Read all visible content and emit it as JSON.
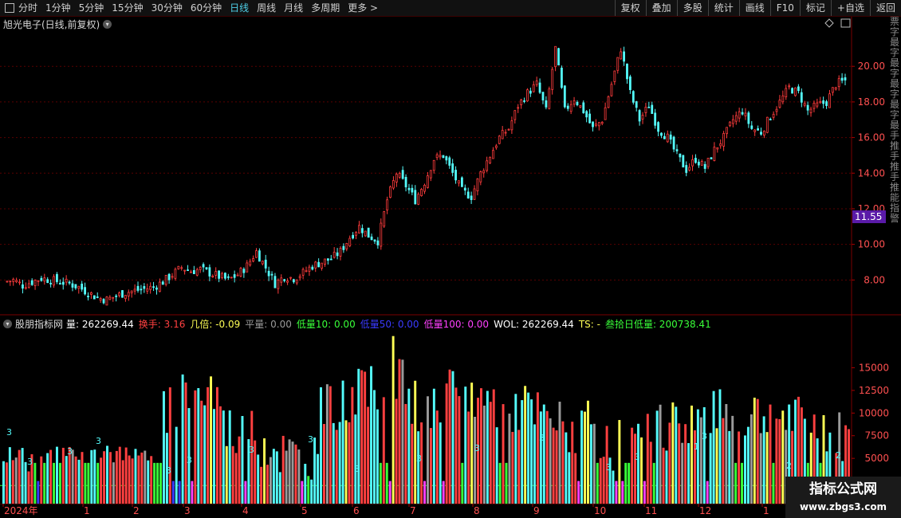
{
  "toolbar": {
    "periods": [
      "分时",
      "1分钟",
      "5分钟",
      "15分钟",
      "30分钟",
      "60分钟",
      "日线",
      "周线",
      "月线",
      "多周期",
      "更多 >"
    ],
    "active_period": "日线",
    "actions": [
      "复权",
      "叠加",
      "多股",
      "统计",
      "画线",
      "F10",
      "标记",
      "+自选",
      "返回"
    ]
  },
  "chart": {
    "title": "旭光电子(日线,前复权)",
    "current_price_label": "11.55",
    "colors": {
      "up": "#ff3c3c",
      "down": "#54fcfc",
      "bg": "#000000",
      "grid": "#5a0000",
      "price_tag_bg": "#5a1aa8"
    }
  },
  "chart_data": [
    {
      "type": "candlestick",
      "title": "旭光电子(日线,前复权)",
      "y_ticks": [
        8.0,
        10.0,
        12.0,
        14.0,
        16.0,
        18.0,
        20.0
      ],
      "ylim": [
        6.0,
        21.8
      ],
      "current_price": 11.55,
      "close_series": [
        7.9,
        8.0,
        7.7,
        7.9,
        8.1,
        8.0,
        7.9,
        7.8,
        7.6,
        7.3,
        7.0,
        6.9,
        7.1,
        7.3,
        7.4,
        7.5,
        7.6,
        7.9,
        8.3,
        8.7,
        8.5,
        8.6,
        8.4,
        8.2,
        8.0,
        8.3,
        8.8,
        9.6,
        8.7,
        7.8,
        8.2,
        8.1,
        8.4,
        8.8,
        9.0,
        9.2,
        9.6,
        10.4,
        11.0,
        10.5,
        10.2,
        12.5,
        14.0,
        13.3,
        12.5,
        13.5,
        14.8,
        15.0,
        14.0,
        13.0,
        12.7,
        14.0,
        15.0,
        16.0,
        16.5,
        17.8,
        18.5,
        19.0,
        17.5,
        21.0,
        17.5,
        18.2,
        17.5,
        16.5,
        17.0,
        19.0,
        21.0,
        18.5,
        17.0,
        17.8,
        16.5,
        16.0,
        15.0,
        14.2,
        14.8,
        14.3,
        15.3,
        16.0,
        17.0,
        17.5,
        16.5,
        16.3,
        17.2,
        18.0,
        18.8,
        18.5,
        17.5,
        17.8,
        18.0,
        19.0,
        19.2
      ],
      "x_ticks": [
        "2024年",
        "1",
        "2",
        "3",
        "4",
        "5",
        "6",
        "7",
        "8",
        "9",
        "10",
        "11",
        "12",
        "1"
      ]
    },
    {
      "type": "bar",
      "title": "股朋指标网",
      "y_ticks": [
        5000,
        7500,
        10000,
        12500,
        15000
      ],
      "ylim": [
        0,
        19000
      ],
      "series_legend": [
        {
          "name": "量",
          "value": "262269.44",
          "color": "#ffffff"
        },
        {
          "name": "换手",
          "value": "3.16",
          "color": "#ff4040"
        },
        {
          "name": "几倍",
          "value": "-0.09",
          "color": "#ffff55"
        },
        {
          "name": "平量",
          "value": "0.00",
          "color": "#9a9a9a"
        },
        {
          "name": "低量10",
          "value": "0.00",
          "color": "#39ff39"
        },
        {
          "name": "低量50",
          "value": "0.00",
          "color": "#3a3aff"
        },
        {
          "name": "低量100",
          "value": "0.00",
          "color": "#ff40ff"
        },
        {
          "name": "WOL",
          "value": "262269.44",
          "color": "#ffffff"
        },
        {
          "name": "TS",
          "value": "-",
          "color": "#ffff55"
        },
        {
          "name": "叁拾日低量",
          "value": "200738.41",
          "color": "#39ff39"
        }
      ]
    }
  ],
  "indicator": {
    "name": "股朋指标网"
  },
  "side_strip": {
    "text": "票字最字最字最字最字最手推手推手推能指警"
  },
  "watermark": {
    "line1": "指标公式网",
    "line2": "www.zbgs3.com"
  }
}
